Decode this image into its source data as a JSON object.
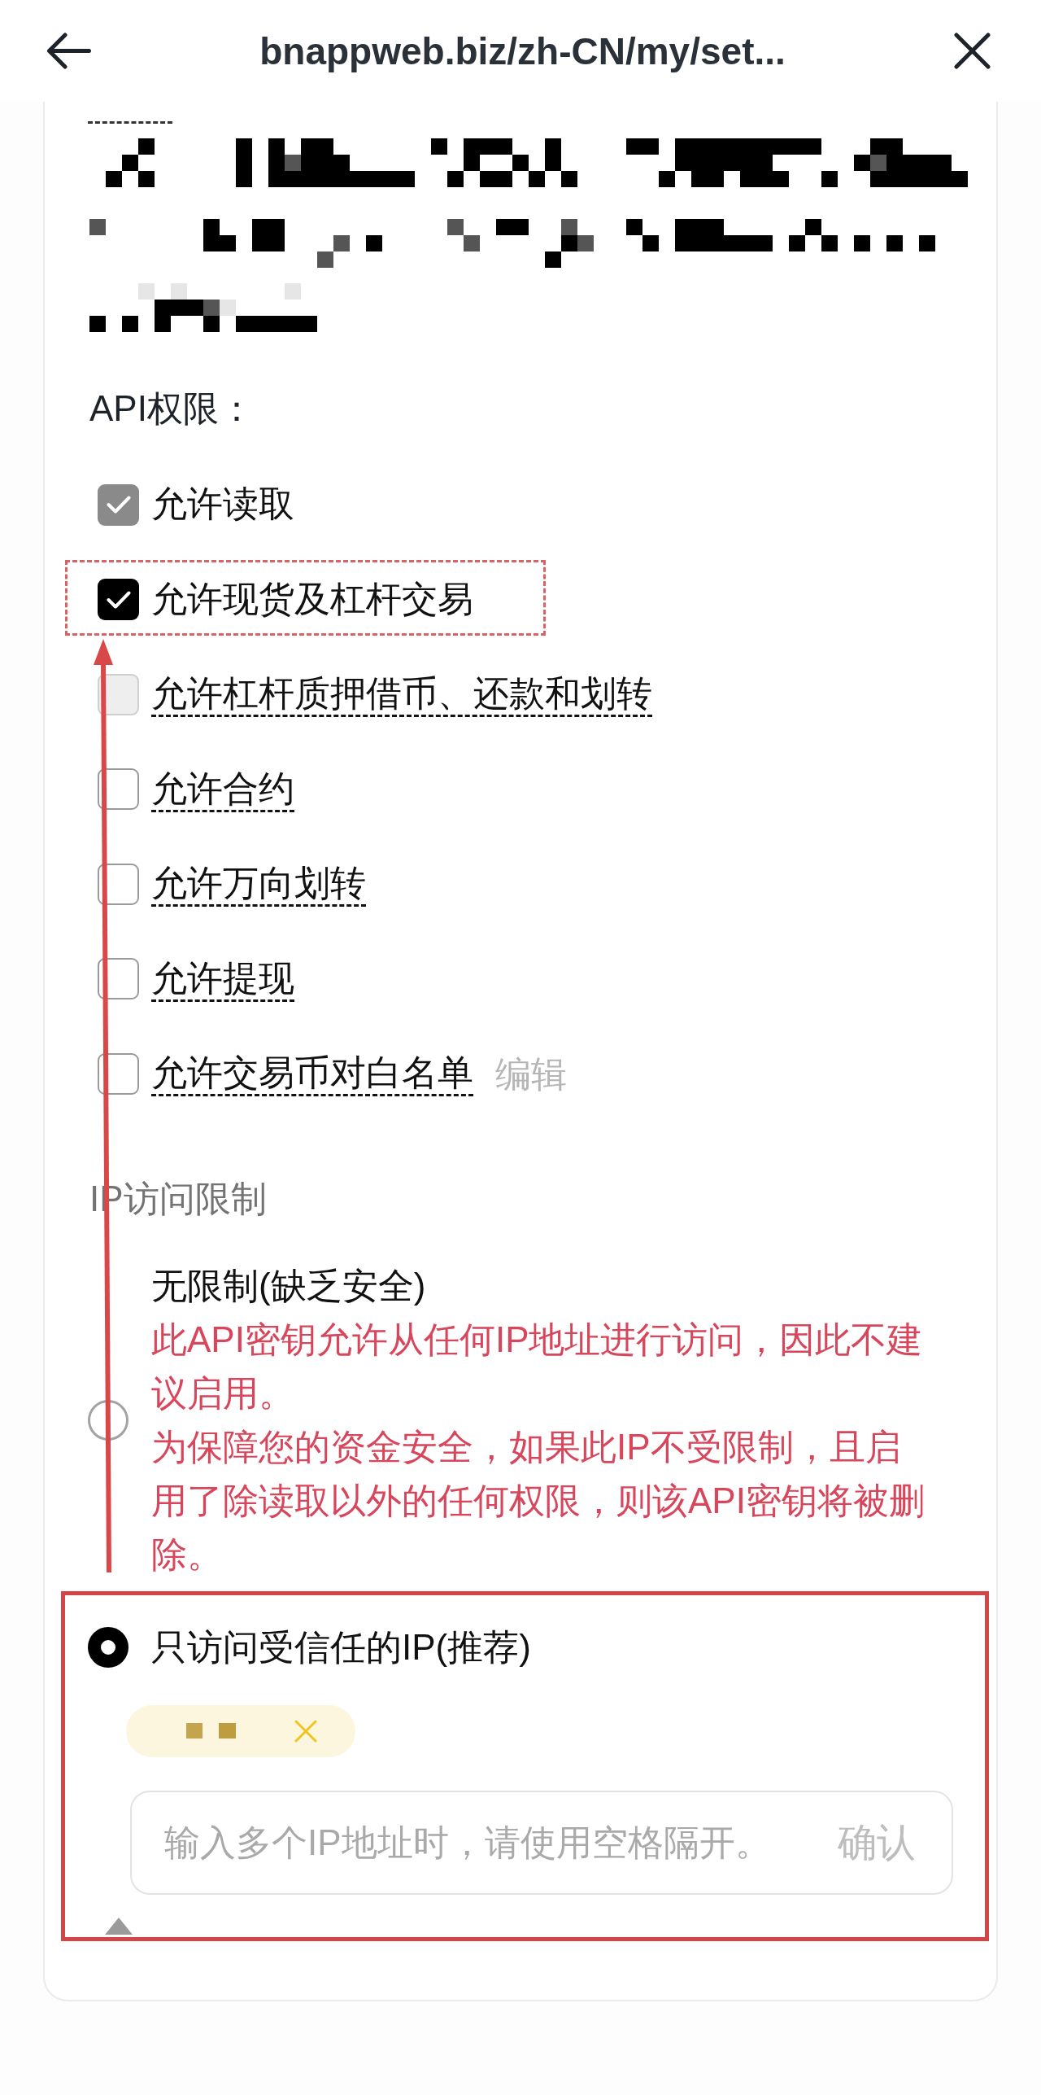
{
  "header": {
    "title": "bnappweb.biz/zh-CN/my/set..."
  },
  "api_permissions": {
    "label": "API权限：",
    "items": [
      {
        "label": "允许读取",
        "checked": true,
        "disabled": true,
        "has_tooltip": false,
        "highlighted": false
      },
      {
        "label": "允许现货及杠杆交易",
        "checked": true,
        "disabled": false,
        "has_tooltip": false,
        "highlighted": true
      },
      {
        "label": "允许杠杆质押借币、还款和划转",
        "checked": false,
        "disabled": true,
        "has_tooltip": true,
        "highlighted": false
      },
      {
        "label": "允许合约",
        "checked": false,
        "disabled": false,
        "has_tooltip": true,
        "highlighted": false
      },
      {
        "label": "允许万向划转",
        "checked": false,
        "disabled": false,
        "has_tooltip": true,
        "highlighted": false
      },
      {
        "label": "允许提现",
        "checked": false,
        "disabled": false,
        "has_tooltip": true,
        "highlighted": false
      },
      {
        "label": "允许交易币对白名单",
        "checked": false,
        "disabled": false,
        "has_tooltip": true,
        "highlighted": false,
        "action": "编辑"
      }
    ]
  },
  "ip_restriction": {
    "label": "IP访问限制",
    "options": [
      {
        "title": "无限制(缺乏安全)",
        "selected": false,
        "highlighted": false,
        "warnings": [
          "此API密钥允许从任何IP地址进行访问，因此不建议启用。",
          "为保障您的资金安全，如果此IP不受限制，且启用了除读取以外的任何权限，则该API密钥将被删除。"
        ]
      },
      {
        "title": "只访问受信任的IP(推荐)",
        "selected": true,
        "highlighted": true,
        "ip_input": {
          "placeholder": "输入多个IP地址时，请使用空格隔开。",
          "confirm": "确认"
        }
      }
    ]
  }
}
